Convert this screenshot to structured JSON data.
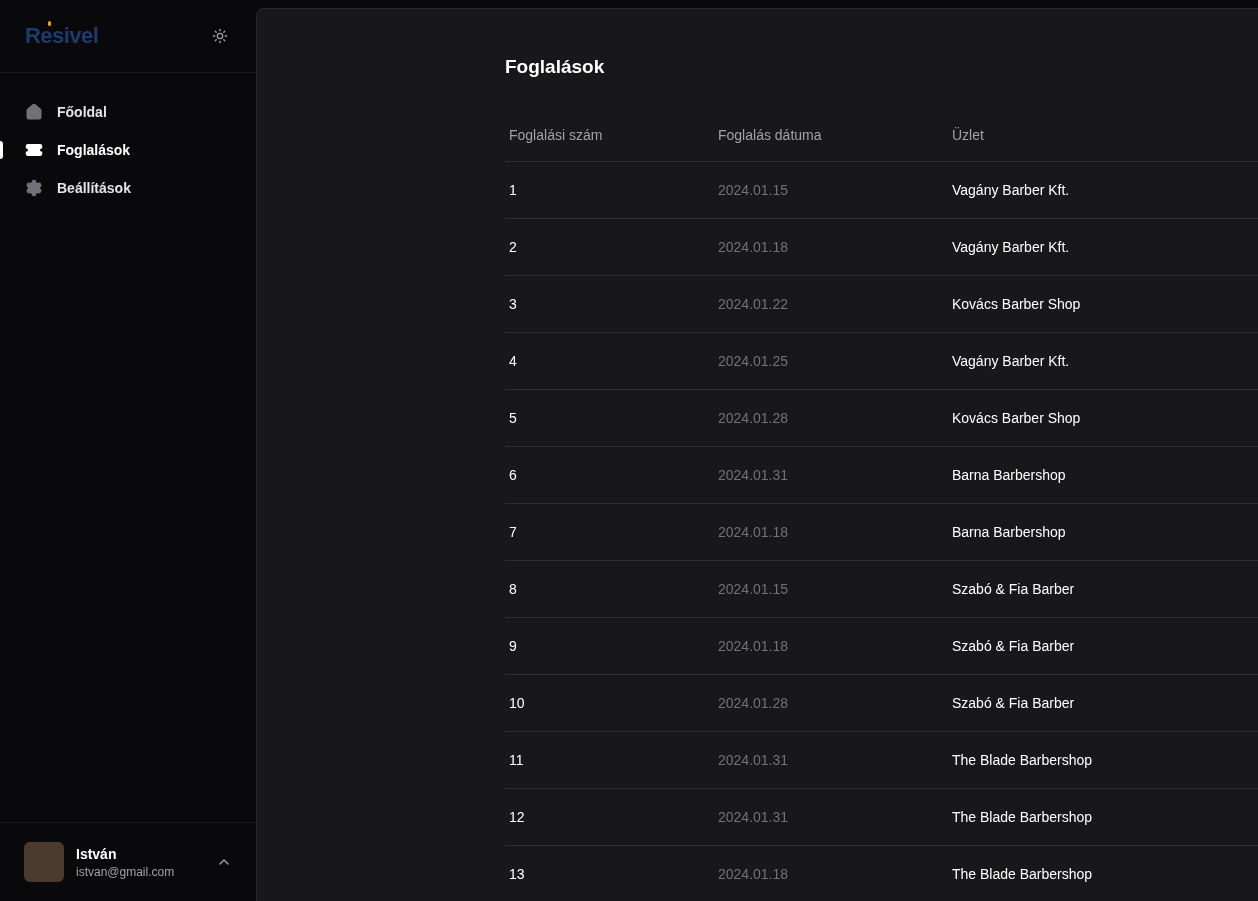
{
  "logo": "Resivel",
  "nav": [
    {
      "label": "Főoldal",
      "selected": false
    },
    {
      "label": "Foglalások",
      "selected": true
    },
    {
      "label": "Beállítások",
      "selected": false
    }
  ],
  "user": {
    "name": "István",
    "email": "istvan@gmail.com"
  },
  "page_title": "Foglalások",
  "table": {
    "columns": [
      "Foglalási szám",
      "Foglalás dátuma",
      "Üzlet"
    ],
    "rows": [
      [
        "1",
        "2024.01.15",
        "Vagány Barber Kft."
      ],
      [
        "2",
        "2024.01.18",
        "Vagány Barber Kft."
      ],
      [
        "3",
        "2024.01.22",
        "Kovács Barber Shop"
      ],
      [
        "4",
        "2024.01.25",
        "Vagány Barber Kft."
      ],
      [
        "5",
        "2024.01.28",
        "Kovács Barber Shop"
      ],
      [
        "6",
        "2024.01.31",
        "Barna Barbershop"
      ],
      [
        "7",
        "2024.01.18",
        "Barna Barbershop"
      ],
      [
        "8",
        "2024.01.15",
        "Szabó & Fia Barber"
      ],
      [
        "9",
        "2024.01.18",
        "Szabó & Fia Barber"
      ],
      [
        "10",
        "2024.01.28",
        "Szabó & Fia Barber"
      ],
      [
        "11",
        "2024.01.31",
        "The Blade Barbershop"
      ],
      [
        "12",
        "2024.01.31",
        "The Blade Barbershop"
      ],
      [
        "13",
        "2024.01.18",
        "The Blade Barbershop"
      ]
    ]
  }
}
